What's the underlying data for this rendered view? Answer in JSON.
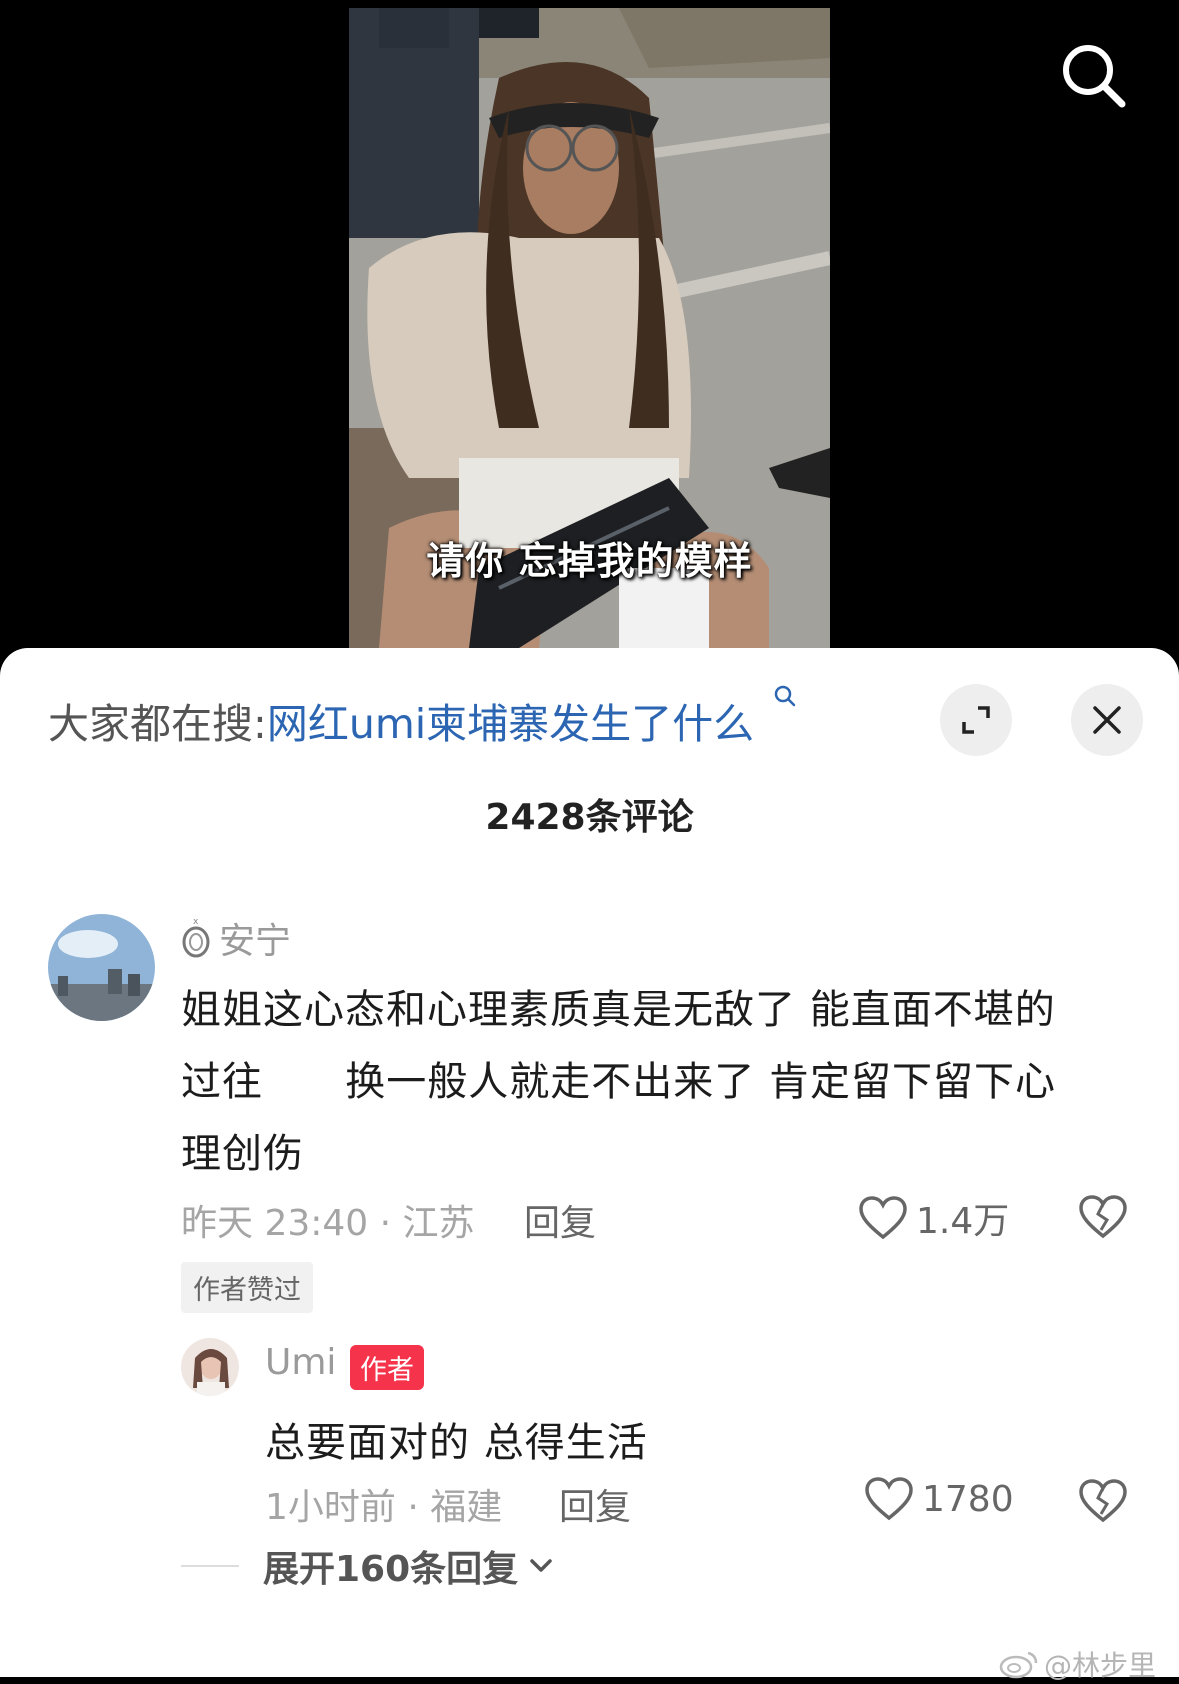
{
  "video": {
    "subtitle": "请你 忘掉我的模样"
  },
  "search": {
    "icon": "search-icon"
  },
  "sheet": {
    "trend_prefix": "大家都在搜:",
    "trend_query": "网红umi柬埔寨发生了什么",
    "comment_count": "2428条评论"
  },
  "comment": {
    "username": "安宁",
    "text_lines": [
      "姐姐这心态和心理素质真是无敌了  能直面不堪的",
      "过往      换一般人就走不出来了 肯定留下留下心",
      "理创伤"
    ],
    "meta": "昨天 23:40 · 江苏",
    "reply_label": "回复",
    "likes": "1.4万",
    "author_liked": "作者赞过"
  },
  "reply": {
    "username": "Umi",
    "badge": "作者",
    "text": "总要面对的 总得生活",
    "meta": "1小时前 · 福建",
    "reply_label": "回复",
    "likes": "1780"
  },
  "expand": {
    "label": "展开160条回复"
  },
  "watermark": "@林步里",
  "colors": {
    "link": "#2c66b3",
    "author_badge": "#f5334b",
    "sheet_bg": "#ffffff"
  }
}
